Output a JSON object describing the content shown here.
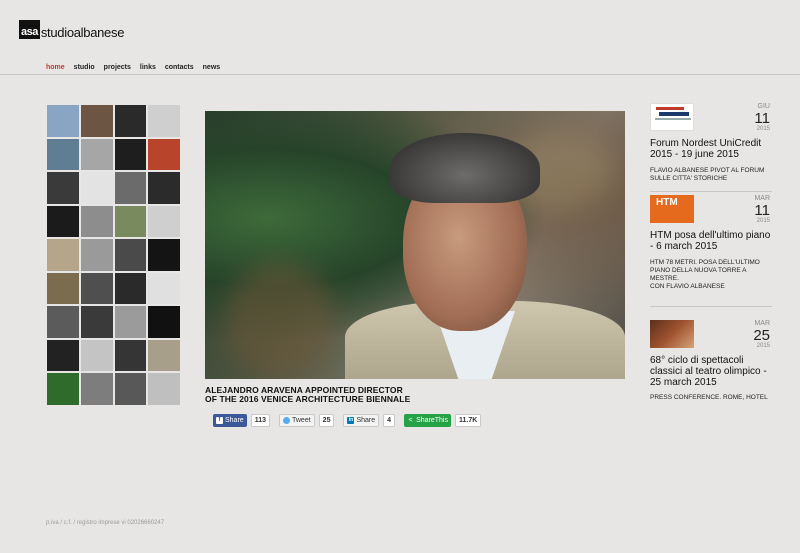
{
  "brand": {
    "logo_mark": "asa",
    "logo_text": "studioalbanese"
  },
  "nav": {
    "items": [
      "home",
      "studio",
      "projects",
      "links",
      "contacts",
      "news"
    ],
    "active": "home"
  },
  "mosaic": {
    "tiles": [
      "#8aa4c4",
      "#6d5544",
      "#2a2a2a",
      "#cfcfcf",
      "#5f7e94",
      "#a6a6a6",
      "#1e1e1e",
      "#b8452b",
      "#3a3a3a",
      "#e3e3e3",
      "#6b6b6b",
      "#2b2b2b",
      "#1b1b1b",
      "#8d8d8d",
      "#7a8a5f",
      "#cfcfcf",
      "#b5a58a",
      "#9a9a9a",
      "#4a4a4a",
      "#141414",
      "#7b6b4f",
      "#4f4f4f",
      "#2a2a2a",
      "#e0e0e0",
      "#5b5b5b",
      "#3a3a3a",
      "#9b9b9b",
      "#111111",
      "#222222",
      "#c4c4c4",
      "#353535",
      "#a89f8a",
      "#2f6b2a",
      "#7d7d7d",
      "#585858",
      "#bfbfbf"
    ]
  },
  "featured": {
    "caption_line1": "ALEJANDRO ARAVENA APPOINTED DIRECTOR",
    "caption_line2": "OF THE 2016 VENICE ARCHITECTURE BIENNALE"
  },
  "share": {
    "facebook_label": "Share",
    "facebook_count": "113",
    "twitter_label": "Tweet",
    "twitter_count": "25",
    "linkedin_label": "Share",
    "linkedin_count": "4",
    "sharethis_label": "ShareThis",
    "sharethis_count": "11.7K"
  },
  "news": [
    {
      "month": "GIU",
      "day": "11",
      "year": "2015",
      "title": "Forum Nordest UniCredit 2015 - 19 june 2015",
      "desc": "FLAVIO ALBANESE PIVOT AL FORUM SULLE CITTA' STORICHE"
    },
    {
      "month": "MAR",
      "day": "11",
      "year": "2015",
      "thumb_text": "HTM",
      "title": "HTM posa dell'ultimo piano - 6 march 2015",
      "desc": "HTM 78 METRI. POSA DELL'ULTIMO PIANO DELLA NUOVA TORRE A MESTRE.\nCON FLAVIO ALBANESE"
    },
    {
      "month": "MAR",
      "day": "25",
      "year": "2015",
      "title": "68° ciclo di spettacoli classici al teatro olimpico - 25 march 2015",
      "desc": "PRESS CONFERENCE. ROME, HOTEL"
    }
  ],
  "footer": {
    "text": "p.iva / c.f. / registro imprese vi 02026660247"
  }
}
